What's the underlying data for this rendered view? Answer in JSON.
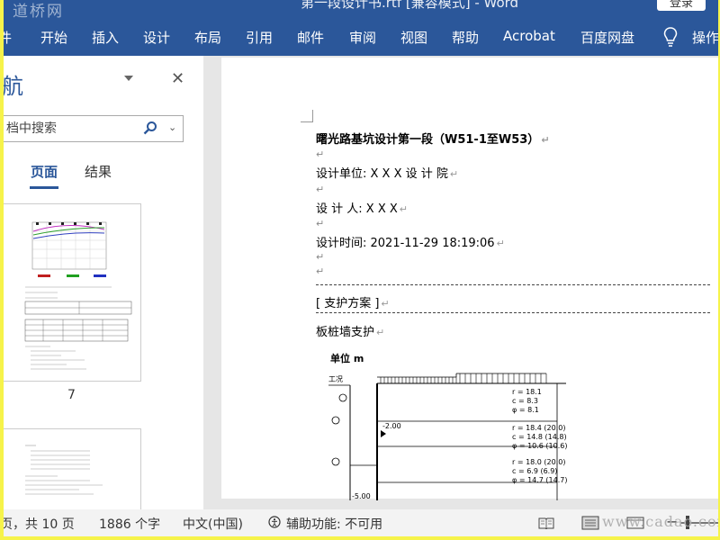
{
  "window": {
    "title": "第一段设计书.rtf [兼容模式] - Word",
    "login_button": "登录",
    "watermark_logo": "道桥网"
  },
  "ribbon": {
    "tabs": [
      "件",
      "开始",
      "插入",
      "设计",
      "布局",
      "引用",
      "邮件",
      "审阅",
      "视图",
      "帮助",
      "Acrobat",
      "百度网盘"
    ],
    "tell_me": "操作",
    "accent_color": "#2b579a"
  },
  "nav": {
    "title": "航",
    "search_placeholder": "档中搜索",
    "tab_pages": "页面",
    "tab_results": "结果",
    "page_thumb_number": "7"
  },
  "document": {
    "heading": "曙光路基坑设计第一段（W51-1至W53）",
    "unit_line": "设计单位: X X X 设 计 院",
    "designer_line": "设 计 人: X X X",
    "time_line": "设计时间: 2021-11-29 18:19:06",
    "section": "[ 支护方案 ]",
    "method": "板桩墙支护",
    "para_mark": "↵",
    "drawing": {
      "unit": "单位 m",
      "layer_label": "工况",
      "level": "-2.00",
      "bottom_level": "-5.00",
      "soil_params": [
        [
          "r = 18.1",
          "c = 8.3",
          "φ = 8.1"
        ],
        [
          "r = 18.4 (20.0)",
          "c = 14.8 (14.8)",
          "φ = 10.6 (10.6)"
        ],
        [
          "r = 18.0 (20.0)",
          "c = 6.9 (6.9)",
          "φ = 14.7 (14.7)"
        ]
      ]
    }
  },
  "status": {
    "pages": "页，共 10 页",
    "words": "1886 个字",
    "language": "中文(中国)",
    "accessibility": "辅助功能: 不可用",
    "watermark": "www.cadao.com"
  }
}
